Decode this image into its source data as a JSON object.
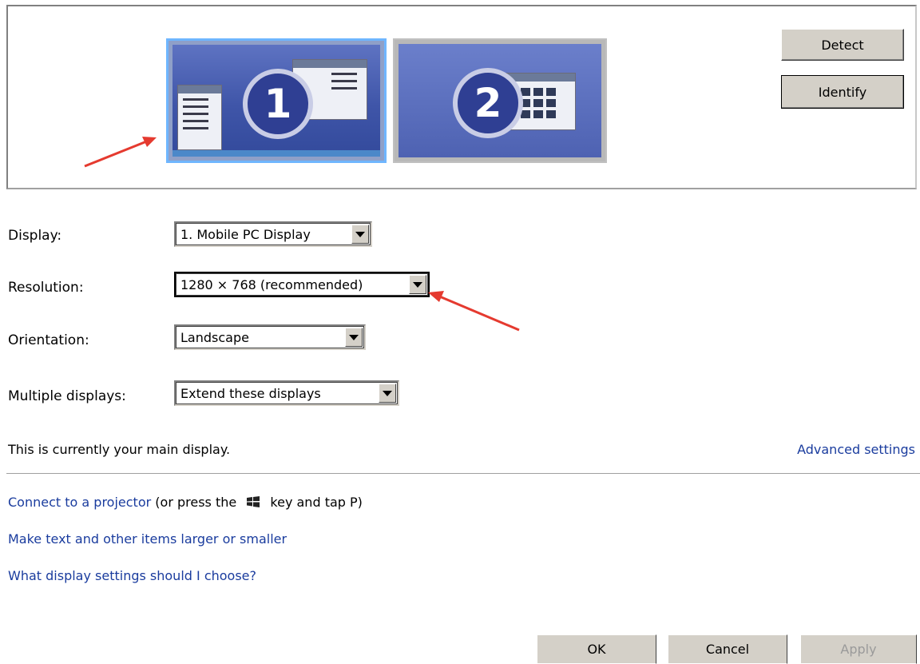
{
  "buttons": {
    "detect": "Detect",
    "identify": "Identify",
    "ok": "OK",
    "cancel": "Cancel",
    "apply": "Apply"
  },
  "monitors": [
    {
      "number": "1",
      "selected": true
    },
    {
      "number": "2",
      "selected": false
    }
  ],
  "fields": {
    "display": {
      "label": "Display:",
      "value": "1. Mobile PC Display"
    },
    "resolution": {
      "label": "Resolution:",
      "value": "1280 × 768 (recommended)"
    },
    "orientation": {
      "label": "Orientation:",
      "value": "Landscape"
    },
    "multiple_displays": {
      "label": "Multiple displays:",
      "value": "Extend these displays"
    }
  },
  "status": "This is currently your main display.",
  "advanced_link": "Advanced settings",
  "links": {
    "projector_link": "Connect to a projector",
    "projector_before_key": "(or press the",
    "projector_after_key": "key and tap P)",
    "text_size": "Make text and other items larger or smaller",
    "help": "What display settings should I choose?"
  },
  "colors": {
    "link": "#1a3c9e",
    "selection_border": "#6fb6ff",
    "annotation_arrow": "#e53a2f"
  },
  "icons": {
    "windows_key": "windows-logo-icon",
    "dropdown": "dropdown-arrow-icon"
  }
}
